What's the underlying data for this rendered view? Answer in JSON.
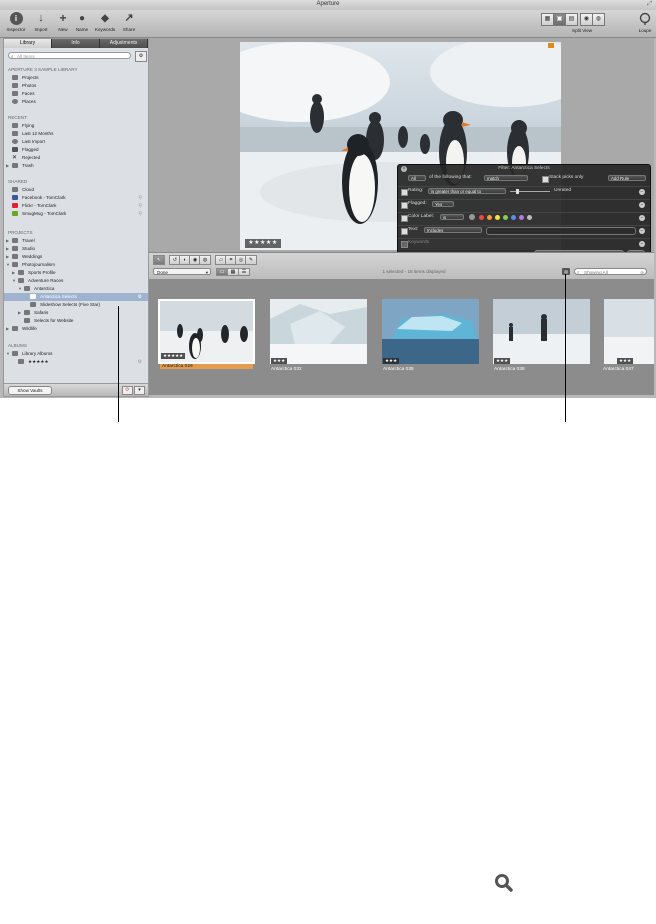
{
  "window": {
    "title": "Aperture"
  },
  "toolbar": {
    "items": [
      {
        "label": "Inspector",
        "icon": "i"
      },
      {
        "label": "Import",
        "icon": "↓"
      },
      {
        "label": "New",
        "icon": "+"
      },
      {
        "label": "Name",
        "icon": "●"
      },
      {
        "label": "Keywords",
        "icon": "◆"
      },
      {
        "label": "Share",
        "icon": "↗"
      }
    ],
    "split_view_label": "Split View",
    "loupe_label": "Loupe"
  },
  "sidebar": {
    "tabs": [
      "Library",
      "Info",
      "Adjustments"
    ],
    "search_placeholder": "All Items",
    "library_header": "APERTURE 3 SAMPLE LIBRARY",
    "library_items": [
      "Projects",
      "Photos",
      "Faces",
      "Places"
    ],
    "recent_header": "RECENT",
    "recent_items": [
      "Flying",
      "Last 12 Months",
      "Last Import",
      "Flagged",
      "Rejected",
      "Trash"
    ],
    "shared_header": "SHARED",
    "shared_items": [
      "Cloud",
      "Facebook - TomClark",
      "Flickr - TomClark",
      "SmugMug - TomClark"
    ],
    "projects_header": "PROJECTS",
    "project_items": [
      "Travel",
      "Studio",
      "Weddings",
      "Photojournalism",
      "Sports Profile",
      "Adventure Races",
      "Antarctica",
      "Antarctica Selects",
      "Slideshow Selects (Five Star)",
      "Safaris",
      "Selects for Website",
      "Wildlife"
    ],
    "albums_header": "ALBUMS",
    "album_items": [
      "Library Albums",
      "★★★★★"
    ],
    "show_vaults": "Show Vaults"
  },
  "viewer": {
    "rating": "★★★★★"
  },
  "filter_hud": {
    "title": "Filter: Antarctica Selects",
    "match_scope": "All",
    "match_text": "of the following that:",
    "match_mode": "match",
    "stack_picks": "Stack picks only",
    "add_rule": "Add Rule",
    "rating_label": "Rating:",
    "rating_op": "is greater than or equal to",
    "rating_value": "Unrated",
    "flagged_label": "Flagged:",
    "flagged_value": "Yes",
    "color_label": "Color Label:",
    "color_op": "is",
    "text_label": "Text:",
    "text_op": "Includes",
    "keywords_label": "Keywords",
    "new_album_button": "New Album With Current Images"
  },
  "browser": {
    "done_label": "Done",
    "status": "1 selected - 18 items displayed",
    "search_placeholder": "Showing All",
    "thumbs": [
      {
        "name": "Antarctica 029",
        "stars": "★★★★★",
        "selected": true
      },
      {
        "name": "Antarctica 032",
        "stars": "★★★",
        "selected": false
      },
      {
        "name": "Antarctica 035",
        "stars": "★★★",
        "selected": false
      },
      {
        "name": "Antarctica 038",
        "stars": "★★★",
        "selected": false
      },
      {
        "name": "Antarctica 047",
        "stars": "★★★",
        "selected": false
      }
    ]
  },
  "colors": {
    "selection": "#9fb3d1",
    "thumb_label_selected": "#e39b4d",
    "flag": "#e08a1e",
    "color_labels": [
      "#e84a4a",
      "#f19c3a",
      "#f3e04b",
      "#7fcf5a",
      "#5b8fe0",
      "#b07ee0",
      "#bdbdbd"
    ]
  }
}
